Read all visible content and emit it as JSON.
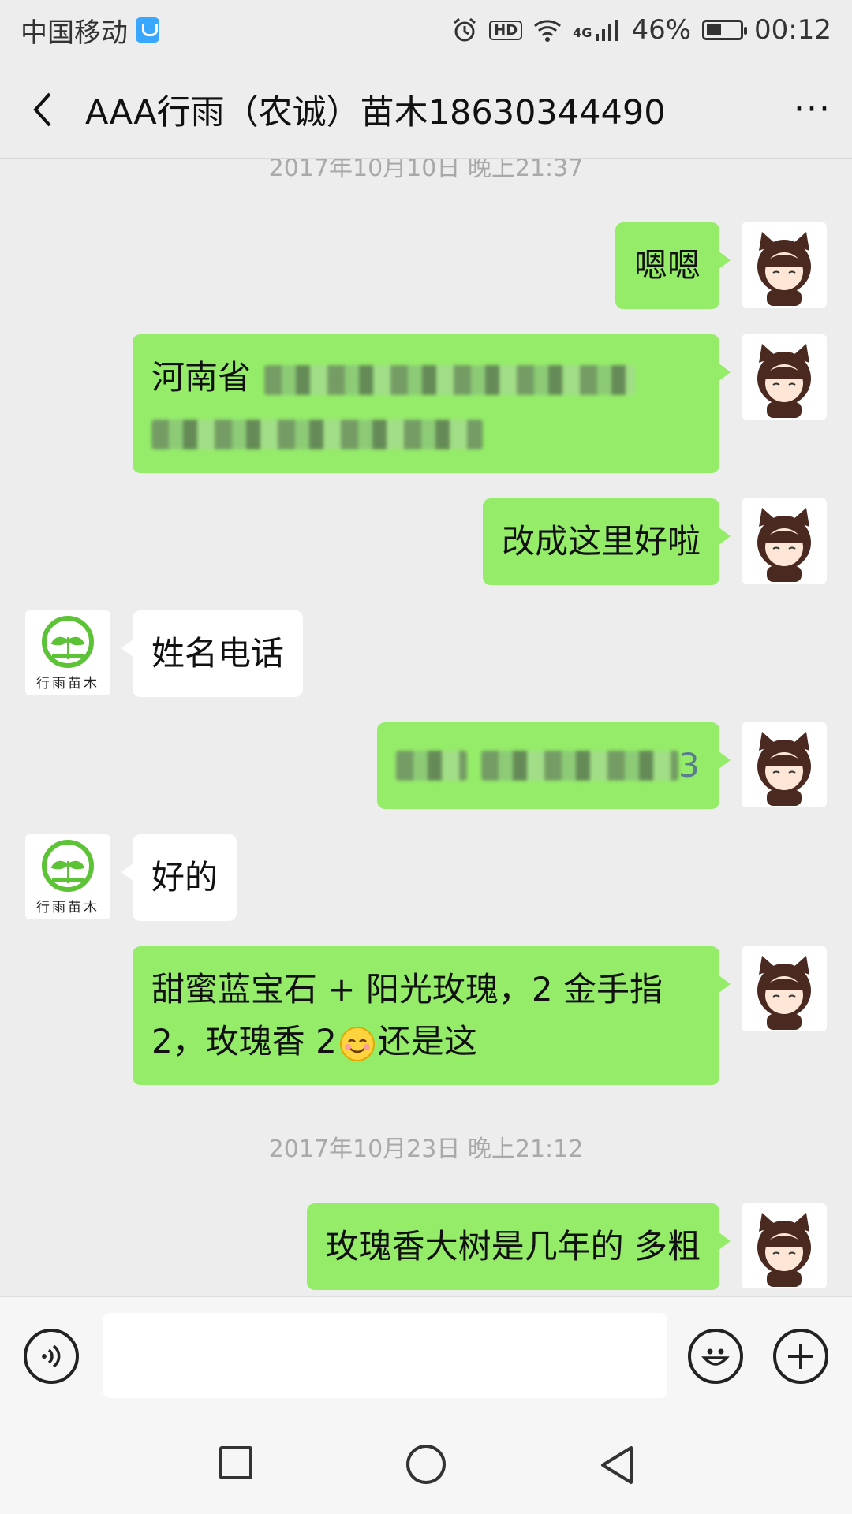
{
  "status_bar": {
    "carrier": "中国移动",
    "battery_percent": "46%",
    "battery_level": 0.46,
    "time": "00:12",
    "hd": "HD",
    "network": "4G"
  },
  "header": {
    "title": "AAA行雨（农诚）苗木18630344490",
    "more_label": "···"
  },
  "messages": [
    {
      "type": "time",
      "text": "2017年10月10日 晚上21:37"
    },
    {
      "sender": "me",
      "text": "嗯嗯"
    },
    {
      "sender": "me",
      "text": "河南省",
      "redacted": true
    },
    {
      "sender": "me",
      "text": "改成这里好啦"
    },
    {
      "sender": "them",
      "text": "姓名电话"
    },
    {
      "sender": "me",
      "text": "3",
      "redacted": true
    },
    {
      "sender": "them",
      "text": "好的"
    },
    {
      "sender": "me",
      "text_line1": "甜蜜蓝宝石 + 阳光玫瑰，2 金手指",
      "text_line2a": "2，玫瑰香 2",
      "text_line2b": "还是这"
    },
    {
      "type": "time",
      "text": "2017年10月23日 晚上21:12"
    },
    {
      "sender": "me",
      "text": "玫瑰香大树是几年的 多粗"
    }
  ],
  "contact_logo": {
    "caption": "行雨苗木"
  },
  "input": {
    "placeholder": ""
  },
  "colors": {
    "my_bubble": "#95ec69",
    "their_bubble": "#ffffff",
    "background": "#ededed"
  }
}
